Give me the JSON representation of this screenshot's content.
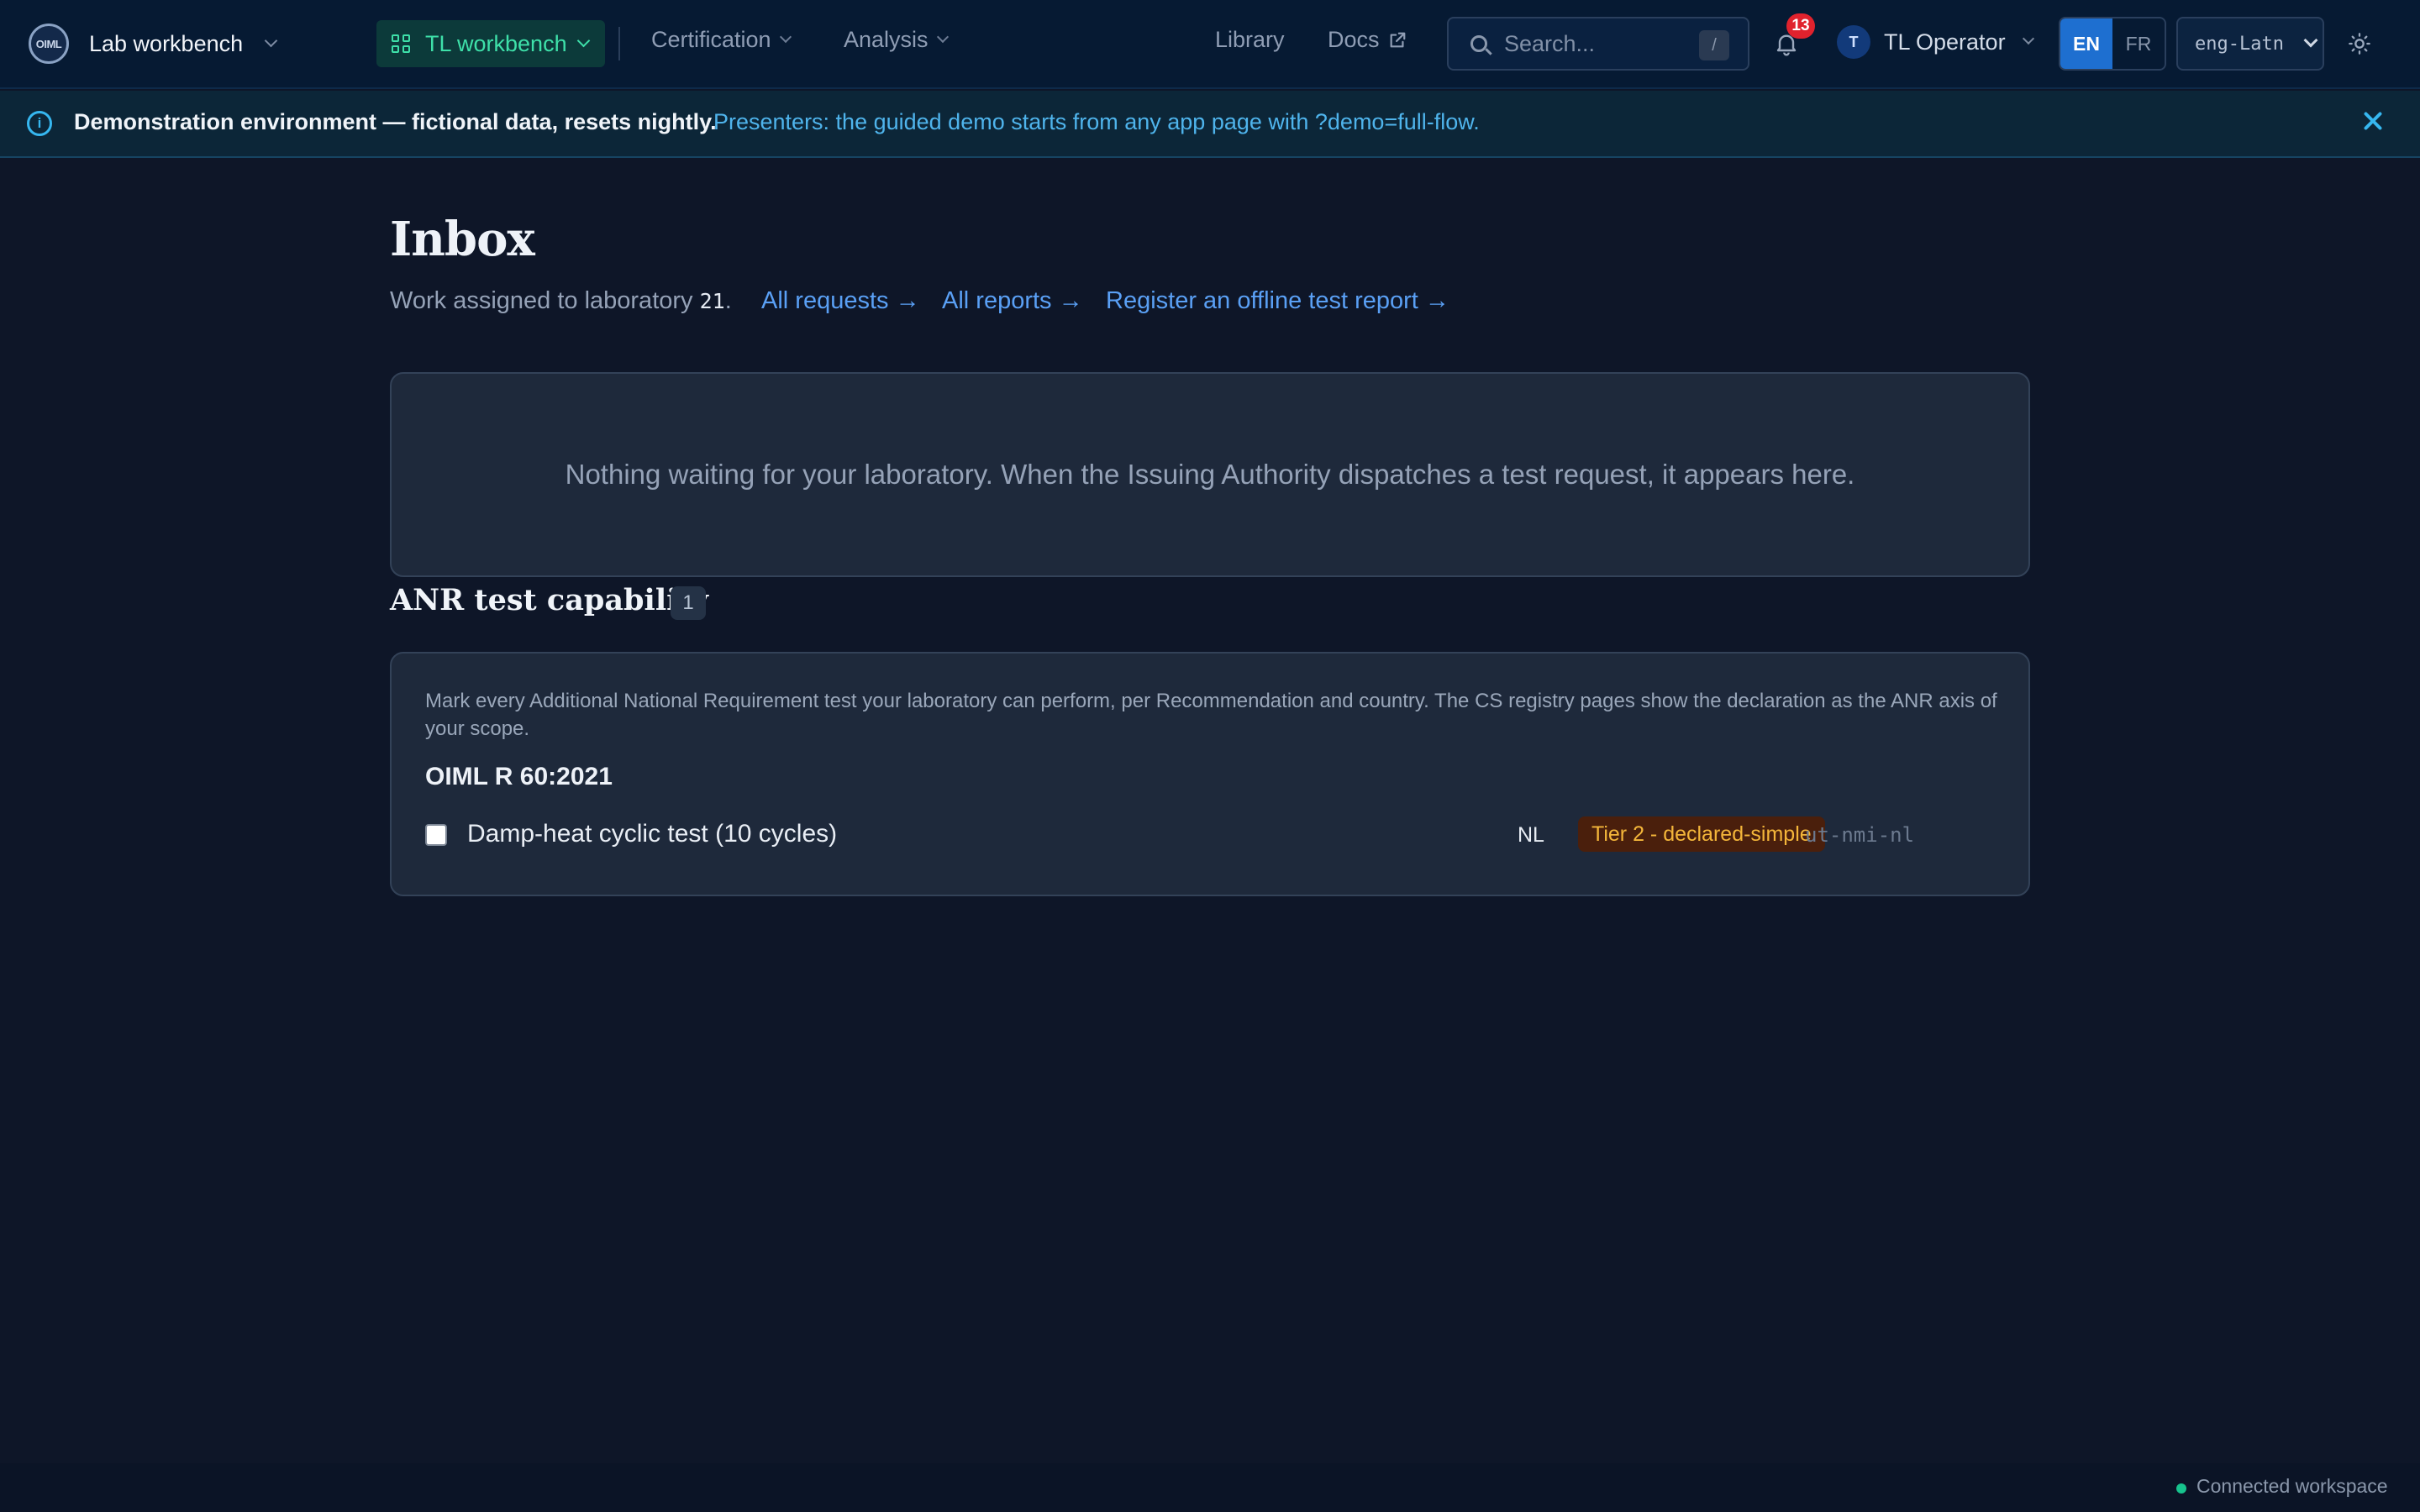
{
  "header": {
    "logo_text": "OIML",
    "brand": "Lab workbench",
    "workbench_label": "TL workbench",
    "nav": [
      "Certification",
      "Analysis"
    ],
    "library": "Library",
    "docs": "Docs",
    "search_placeholder": "Search...",
    "search_shortcut": "/",
    "notifications_count": "13",
    "user_initial": "T",
    "user_name": "TL Operator",
    "lang_active": "EN",
    "lang_other": "FR",
    "script_select": "eng-Latn",
    "icons": [
      "chevron-down-icon",
      "grid-icon",
      "external-link-icon",
      "search-icon",
      "bell-icon",
      "sun-icon"
    ]
  },
  "banner": {
    "strong": "Demonstration environment — fictional data, resets nightly.",
    "link": "Presenters: the guided demo starts from any app page with ?demo=full-flow.",
    "icons": [
      "info-icon",
      "close-icon"
    ]
  },
  "main": {
    "title": "Inbox",
    "subtitle_prefix": "Work assigned to laboratory",
    "lab_number": "21",
    "subtitle_suffix": ".",
    "links": [
      "All requests →",
      "All reports →",
      "Register an offline test report →"
    ],
    "empty_message": "Nothing waiting for your laboratory. When the Issuing Authority dispatches a test request, it appears here."
  },
  "capability": {
    "title": "ANR test capability",
    "count": "1",
    "description": "Mark every Additional National Requirement test your laboratory can perform, per Recommendation and country. The CS registry pages show the declaration as the ANR axis of your scope.",
    "recommendation": "OIML R 60:2021",
    "rows": [
      {
        "test": "Damp-heat cyclic test (10 cycles)",
        "country": "NL",
        "tier": "Tier 2 - declared-simple",
        "code": "ut-nmi-nl",
        "checked": false
      }
    ]
  },
  "footer": {
    "status": "Connected workspace",
    "status_color": "#17c38d"
  }
}
